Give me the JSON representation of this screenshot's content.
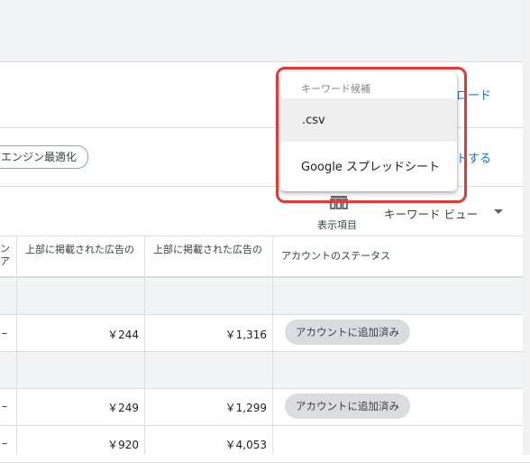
{
  "toolbar": {
    "download_link": "ロード",
    "apply_link": "トする",
    "chip_label": "エンジン最適化"
  },
  "view": {
    "columns_label": "表示項目",
    "keyword_view_label": "キーワード ビュー"
  },
  "table": {
    "headers": [
      "ン\nア",
      "上部に掲載された広告の",
      "上部に掲載された広告の",
      "アカウントのステータス"
    ],
    "rows": [
      {
        "dash": "–",
        "low": "￥244",
        "high": "￥1,316",
        "status": "アカウントに追加済み"
      },
      {
        "dash": "–",
        "low": "￥249",
        "high": "￥1,299",
        "status": "アカウントに追加済み"
      },
      {
        "dash": "–",
        "low": "￥920",
        "high": "￥4,053",
        "status": ""
      }
    ]
  },
  "menu": {
    "title": "キーワード候補",
    "items": [
      ".csv",
      "Google スプレッドシート"
    ]
  },
  "colors": {
    "accent": "#1a73e8",
    "highlight_border": "#e53935",
    "status_chip_bg": "#dadce0"
  },
  "icons": {
    "columns": "columns-icon",
    "dropdown": "caret-down-icon"
  }
}
